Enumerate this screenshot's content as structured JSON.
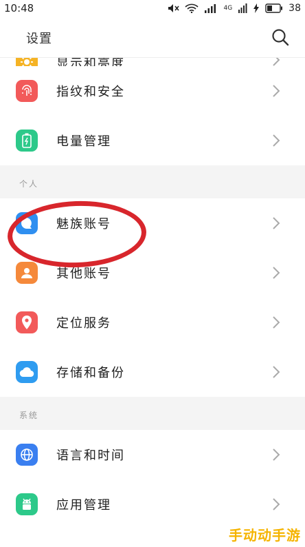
{
  "status_bar": {
    "time": "10:48",
    "network": "4G",
    "battery": "38"
  },
  "header": {
    "title": "设置"
  },
  "rows_top": [
    {
      "label": "显示和亮度",
      "icon": "brightness-icon",
      "color": "#f5b325"
    },
    {
      "label": "指纹和安全",
      "icon": "fingerprint-icon",
      "color": "#f25a5a"
    },
    {
      "label": "电量管理",
      "icon": "battery-icon",
      "color": "#2dc98a"
    }
  ],
  "section_personal": {
    "title": "个人"
  },
  "rows_personal": [
    {
      "label": "魅族账号",
      "icon": "chat-bubble-icon",
      "color": "#2f8ff0"
    },
    {
      "label": "其他账号",
      "icon": "person-icon",
      "color": "#f5893b"
    },
    {
      "label": "定位服务",
      "icon": "location-pin-icon",
      "color": "#f25a5a"
    },
    {
      "label": "存储和备份",
      "icon": "cloud-icon",
      "color": "#2f9cf0"
    }
  ],
  "section_system": {
    "title": "系统"
  },
  "rows_system": [
    {
      "label": "语言和时间",
      "icon": "globe-icon",
      "color": "#3a7ff0"
    },
    {
      "label": "应用管理",
      "icon": "android-icon",
      "color": "#2dc98a"
    }
  ],
  "watermark": "手动动手游"
}
